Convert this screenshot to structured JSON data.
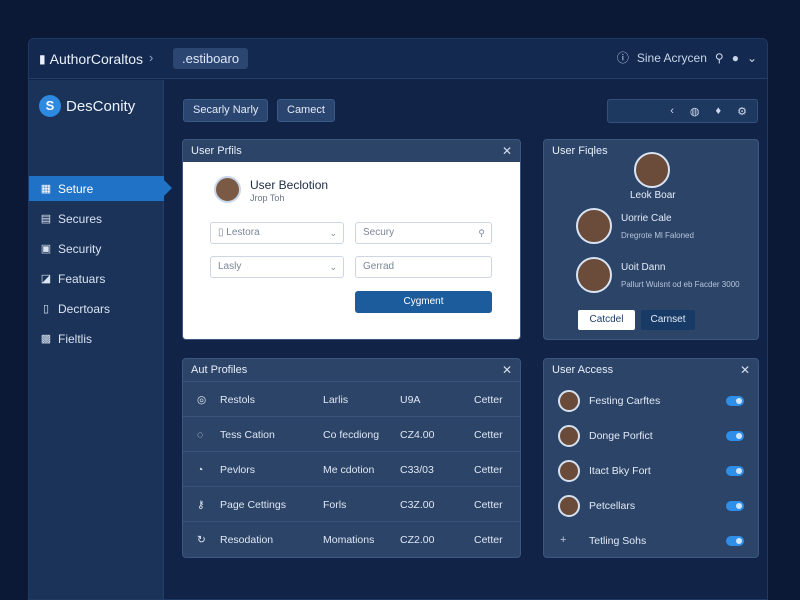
{
  "topbar": {
    "brand": "AuthorCoraltos",
    "crumb_sep": "›",
    "crumb": ".estiboaro",
    "user": "Sine Acrycen"
  },
  "sidebar": {
    "logo": "DesConity",
    "items": [
      {
        "label": "Seture",
        "icon": "calendar-icon",
        "active": true
      },
      {
        "label": "Secures",
        "icon": "document-icon"
      },
      {
        "label": "Security",
        "icon": "clipboard-icon"
      },
      {
        "label": "Featuars",
        "icon": "chat-icon"
      },
      {
        "label": "Decrtoars",
        "icon": "file-icon"
      },
      {
        "label": "Fieltlis",
        "icon": "grid-icon"
      }
    ]
  },
  "toolbar": {
    "btn1": "Secarly Narly",
    "btn2": "Camect"
  },
  "profile_form": {
    "title": "User Prfils",
    "name": "User Beclotion",
    "sub": "Jrop Toh",
    "field1": "Lestora",
    "field2": "Secury",
    "field3": "Lasly",
    "field4": "Gerrad",
    "submit": "Cygment"
  },
  "user_profiles": {
    "title": "User Fiqles",
    "top_name": "Leok Boar",
    "users": [
      {
        "name": "Uorrie Cale",
        "sub": "Dregrote Ml Faloned"
      },
      {
        "name": "Uoit Dann",
        "sub": "Pallurt Wulsnt od eb Facder 3000"
      }
    ],
    "btn_cancel": "Catcdel",
    "btn_confirm": "Carnset"
  },
  "all_profiles": {
    "title": "Aut Profiles",
    "rows": [
      {
        "name": "Restols",
        "type": "Larlis",
        "code": "U9A",
        "status": "Cetter",
        "icon": "globe-icon"
      },
      {
        "name": "Tess Cation",
        "type": "Co fecdiong",
        "code": "CZ4.00",
        "status": "Cetter",
        "icon": "chat-icon"
      },
      {
        "name": "Pevlors",
        "type": "Me cdotion",
        "code": "C33/03",
        "status": "Cetter",
        "icon": "gauge-icon"
      },
      {
        "name": "Page Cettings",
        "type": "Forls",
        "code": "C3Z.00",
        "status": "Cetter",
        "icon": "key-icon"
      },
      {
        "name": "Resodation",
        "type": "Momations",
        "code": "CZ2.00",
        "status": "Cetter",
        "icon": "refresh-icon"
      }
    ]
  },
  "user_access": {
    "title": "User Access",
    "rows": [
      {
        "label": "Festing Carftes",
        "on": true
      },
      {
        "label": "Donge Porfict",
        "on": true
      },
      {
        "label": "Itact Bky Fort",
        "on": true
      },
      {
        "label": "Petcellars",
        "on": true
      },
      {
        "label": "Tetling Sohs",
        "on": true
      }
    ]
  }
}
